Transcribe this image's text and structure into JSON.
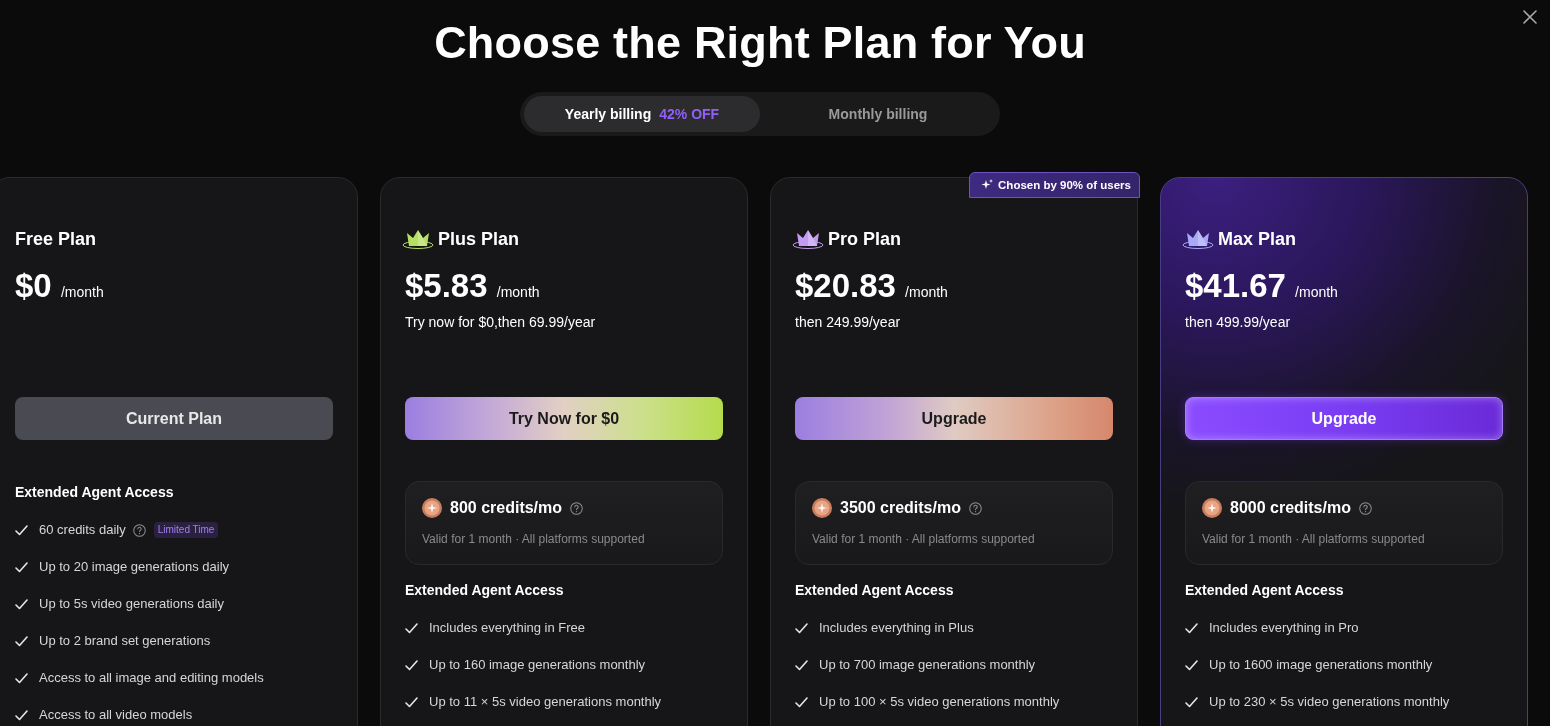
{
  "dialog": {
    "title": "Choose the Right Plan for You"
  },
  "billing_tabs": [
    {
      "label": "Yearly billing",
      "discount": "42% OFF",
      "selected": true
    },
    {
      "label": "Monthly billing",
      "selected": false
    }
  ],
  "plans": [
    {
      "name": "Free Plan",
      "highlighted": false,
      "price": "$0",
      "period": "/month",
      "button": {
        "label": "Current Plan",
        "kind": "current"
      },
      "features_heading": "Extended Agent Access",
      "features": [
        {
          "text": "60 credits daily",
          "help": true,
          "tag": "Limited Time"
        },
        {
          "text": "Up to 20 image generations daily"
        },
        {
          "text": "Up to 5s video generations daily"
        },
        {
          "text": "Up to 2 brand set generations"
        },
        {
          "text": "Access to all image and editing models"
        },
        {
          "text": "Access to all video models"
        }
      ]
    },
    {
      "name": "Plus Plan",
      "color": "#b4df62",
      "highlighted": false,
      "price": "$5.83",
      "period": "/month",
      "note": "Try now for $0,then 69.99/year",
      "button": {
        "label": "Try Now for $0",
        "kind": "trial"
      },
      "credits": {
        "amount": "800 credits/mo",
        "note": "Valid for 1 month · All platforms supported"
      },
      "features_heading": "Extended Agent Access",
      "features": [
        {
          "text": "Includes everything in Free"
        },
        {
          "text": "Up to 160 image generations monthly"
        },
        {
          "text": "Up to 11 × 5s video generations monthly"
        }
      ]
    },
    {
      "name": "Pro Plan",
      "color": "#c39cf2",
      "badge": "Chosen by 90% of users",
      "highlighted": false,
      "price": "$20.83",
      "period": "/month",
      "note": "then 249.99/year",
      "button": {
        "label": "Upgrade",
        "kind": "warm"
      },
      "credits": {
        "amount": "3500 credits/mo",
        "note": "Valid for 1 month · All platforms supported"
      },
      "features_heading": "Extended Agent Access",
      "features": [
        {
          "text": "Includes everything in Plus"
        },
        {
          "text": "Up to 700 image generations monthly"
        },
        {
          "text": "Up to 100 × 5s video generations monthly"
        }
      ]
    },
    {
      "name": "Max Plan",
      "color": "#a9a9f7",
      "highlighted": true,
      "price": "$41.67",
      "period": "/month",
      "note": "then 499.99/year",
      "button": {
        "label": "Upgrade",
        "kind": "primary"
      },
      "credits": {
        "amount": "8000 credits/mo",
        "note": "Valid for 1 month · All platforms supported"
      },
      "features_heading": "Extended Agent Access",
      "features": [
        {
          "text": "Includes everything in Pro"
        },
        {
          "text": "Up to 1600 image generations monthly"
        },
        {
          "text": "Up to 230 × 5s video generations monthly"
        }
      ]
    }
  ]
}
